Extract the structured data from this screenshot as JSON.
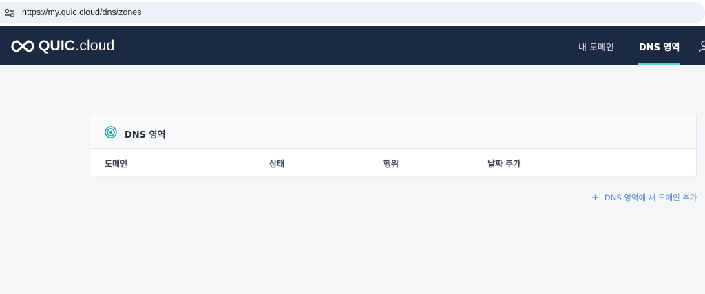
{
  "browser": {
    "url": "https://my.quic.cloud/dns/zones"
  },
  "header": {
    "logo_bold": "QUIC",
    "logo_thin": ".cloud",
    "nav": [
      {
        "label": "내 도메인",
        "active": false
      },
      {
        "label": "DNS 영역",
        "active": true
      }
    ]
  },
  "card": {
    "title": "DNS 영역",
    "columns": [
      "도메인",
      "상태",
      "행위",
      "날짜 추가"
    ]
  },
  "actions": {
    "add_domain_label": "DNS 영역에 새 도메인 추가"
  },
  "colors": {
    "header_bg": "#1b2941",
    "accent": "#5ad6cf",
    "link": "#5b8bd6",
    "icon_teal": "#1fa6a0"
  },
  "icons": {
    "site_info": "tune-icon",
    "logo": "quic-cloud-logo-icon",
    "user": "user-icon",
    "card": "target-icon",
    "add": "plus-icon"
  }
}
